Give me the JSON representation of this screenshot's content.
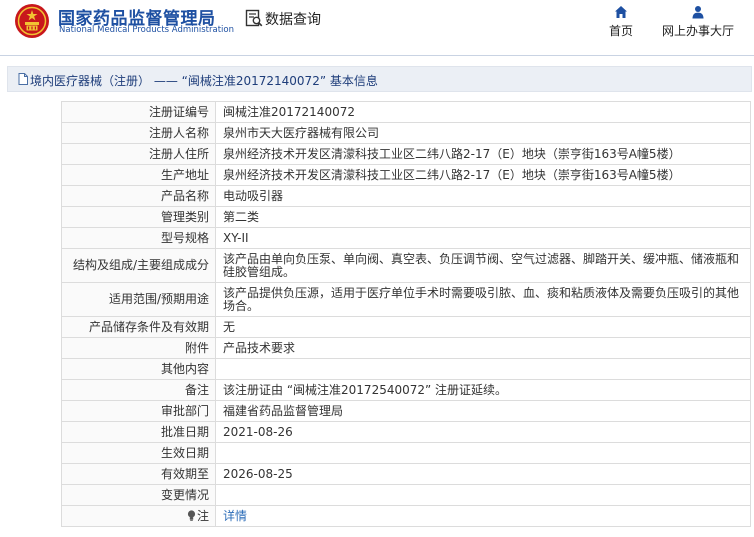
{
  "header": {
    "site_title_cn": "国家药品监督管理局",
    "site_title_en": "National Medical Products Administration",
    "section_title": "数据查询",
    "nav": {
      "home_label": "首页",
      "service_hall_label": "网上办事大厅"
    }
  },
  "colors": {
    "brand_blue": "#1e50a2",
    "emblem_red": "#c8171c",
    "emblem_gold": "#f1c232",
    "link_blue": "#2b6cb8"
  },
  "breadcrumb": {
    "text": "境内医疗器械（注册） —— “闽械注准20172140072” 基本信息"
  },
  "details": {
    "rows": [
      {
        "label": "注册证编号",
        "value": "闽械注准20172140072"
      },
      {
        "label": "注册人名称",
        "value": "泉州市天大医疗器械有限公司"
      },
      {
        "label": "注册人住所",
        "value": "泉州经济技术开发区清濛科技工业区二纬八路2-17（E）地块（崇亨街163号A幢5楼）"
      },
      {
        "label": "生产地址",
        "value": "泉州经济技术开发区清濛科技工业区二纬八路2-17（E）地块（崇亨街163号A幢5楼）"
      },
      {
        "label": "产品名称",
        "value": "电动吸引器"
      },
      {
        "label": "管理类别",
        "value": "第二类"
      },
      {
        "label": "型号规格",
        "value": "XY-II"
      },
      {
        "label": "结构及组成/主要组成成分",
        "value": "该产品由单向负压泵、单向阀、真空表、负压调节阀、空气过滤器、脚踏开关、缓冲瓶、储液瓶和硅胶管组成。"
      },
      {
        "label": "适用范围/预期用途",
        "value": "该产品提供负压源，适用于医疗单位手术时需要吸引脓、血、痰和粘质液体及需要负压吸引的其他场合。"
      },
      {
        "label": "产品储存条件及有效期",
        "value": "无"
      },
      {
        "label": "附件",
        "value": "产品技术要求"
      },
      {
        "label": "其他内容",
        "value": ""
      },
      {
        "label": "备注",
        "value": "该注册证由 “闽械注准20172540072” 注册证延续。"
      },
      {
        "label": "审批部门",
        "value": "福建省药品监督管理局"
      },
      {
        "label": "批准日期",
        "value": "2021-08-26"
      },
      {
        "label": "生效日期",
        "value": ""
      },
      {
        "label": "有效期至",
        "value": "2026-08-25"
      },
      {
        "label": "变更情况",
        "value": ""
      }
    ],
    "note": {
      "label": "注",
      "link_text": "详情"
    }
  }
}
